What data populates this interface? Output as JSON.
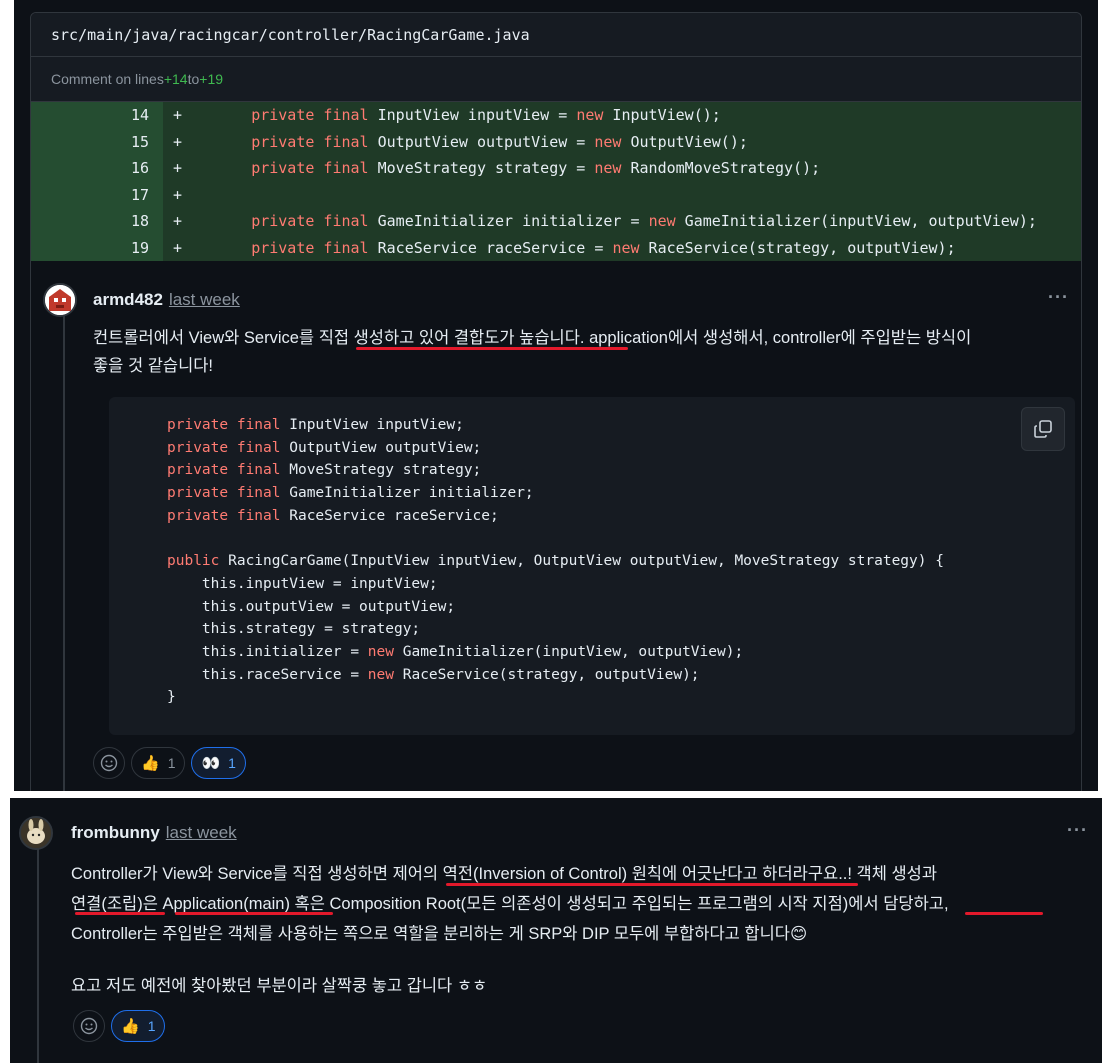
{
  "file": {
    "path": "src/main/java/racingcar/controller/RacingCarGame.java",
    "comment_on_prefix": "Comment on lines ",
    "range_start": "+14",
    "range_to": " to ",
    "range_end": "+19"
  },
  "diff_lines": [
    {
      "num": "14",
      "sign": "+",
      "kw": "private final",
      "rest": " InputView inputView = ",
      "kw2": "new",
      "rest2": " InputView();"
    },
    {
      "num": "15",
      "sign": "+",
      "kw": "private final",
      "rest": " OutputView outputView = ",
      "kw2": "new",
      "rest2": " OutputView();"
    },
    {
      "num": "16",
      "sign": "+",
      "kw": "private final",
      "rest": " MoveStrategy strategy = ",
      "kw2": "new",
      "rest2": " RandomMoveStrategy();"
    },
    {
      "num": "17",
      "sign": "+",
      "kw": "",
      "rest": "",
      "kw2": "",
      "rest2": ""
    },
    {
      "num": "18",
      "sign": "+",
      "kw": "private final",
      "rest": " GameInitializer initializer = ",
      "kw2": "new",
      "rest2": " GameInitializer(inputView, outputView);"
    },
    {
      "num": "19",
      "sign": "+",
      "kw": "private final",
      "rest": " RaceService raceService = ",
      "kw2": "new",
      "rest2": " RaceService(strategy, outputView);"
    }
  ],
  "comment1": {
    "author": "armd482",
    "time": "last week",
    "more": "···",
    "line1_a": "컨트롤러에서 View와 Service를 ",
    "line1_b": "직접 생성하고 있어 결합도가 높습니다",
    "line1_c": ". application에서 생성해서, controller에 주입받는 방식이",
    "line2": "좋을 것 같습니다!",
    "code": [
      {
        "kw": "private final",
        "rest": " InputView inputView;"
      },
      {
        "kw": "private final",
        "rest": " OutputView outputView;"
      },
      {
        "kw": "private final",
        "rest": " MoveStrategy strategy;"
      },
      {
        "kw": "private final",
        "rest": " GameInitializer initializer;"
      },
      {
        "kw": "private final",
        "rest": " RaceService raceService;"
      },
      {
        "kw": "",
        "rest": ""
      },
      {
        "kw": "public",
        "rest": " RacingCarGame(InputView inputView, OutputView outputView, MoveStrategy strategy) {"
      },
      {
        "pre": "    ",
        "kw": "",
        "rest": "this.inputView = inputView;"
      },
      {
        "pre": "    ",
        "kw": "",
        "rest": "this.outputView = outputView;"
      },
      {
        "pre": "    ",
        "kw": "",
        "rest": "this.strategy = strategy;"
      },
      {
        "pre": "    ",
        "kw": "",
        "rest": "this.initializer = ",
        "kw2": "new",
        "rest2": " GameInitializer(inputView, outputView);"
      },
      {
        "pre": "    ",
        "kw": "",
        "rest": "this.raceService = ",
        "kw2": "new",
        "rest2": " RaceService(strategy, outputView);"
      },
      {
        "kw": "",
        "rest": "}"
      }
    ],
    "reactions": [
      {
        "emoji": "👍",
        "count": "1",
        "active": false
      },
      {
        "emoji": "👀",
        "count": "1",
        "active": true
      }
    ]
  },
  "comment2": {
    "author": "frombunny",
    "time": "last week",
    "more": "···",
    "line1_a": "Controller가 View와 Service를 직접 생성하면 ",
    "line1_b": "제어의 역전(Inversion of Control) 원칙에 어긋난다고",
    "line1_c": " 하더라구요..! 객체 생성과",
    "line2_a": "연결(조립)",
    "line2_b": "은 ",
    "line2_c": "Application(main)",
    "line2_d": " 혹은 Composition Root(모든 의존성이 생성되고 주입되는 프로그램의 시작 지점)",
    "line2_e": "에서 담당",
    "line2_f": "하고,",
    "line3": "Controller는 주입받은 객체를 사용하는 쪽으로 역할을 분리하는 게 SRP와 DIP 모두에 부합하다고 합니다😊",
    "line4": "요고 저도 예전에 찾아봤던 부분이라 살짝쿵 놓고 갑니다 ㅎㅎ",
    "reactions": [
      {
        "emoji": "👍",
        "count": "1",
        "active": true
      }
    ]
  },
  "colors": {
    "accent": "#1f6feb",
    "underline": "#e3192b",
    "keyword": "#ff7b72",
    "addition_bg": "#1f3a27"
  }
}
